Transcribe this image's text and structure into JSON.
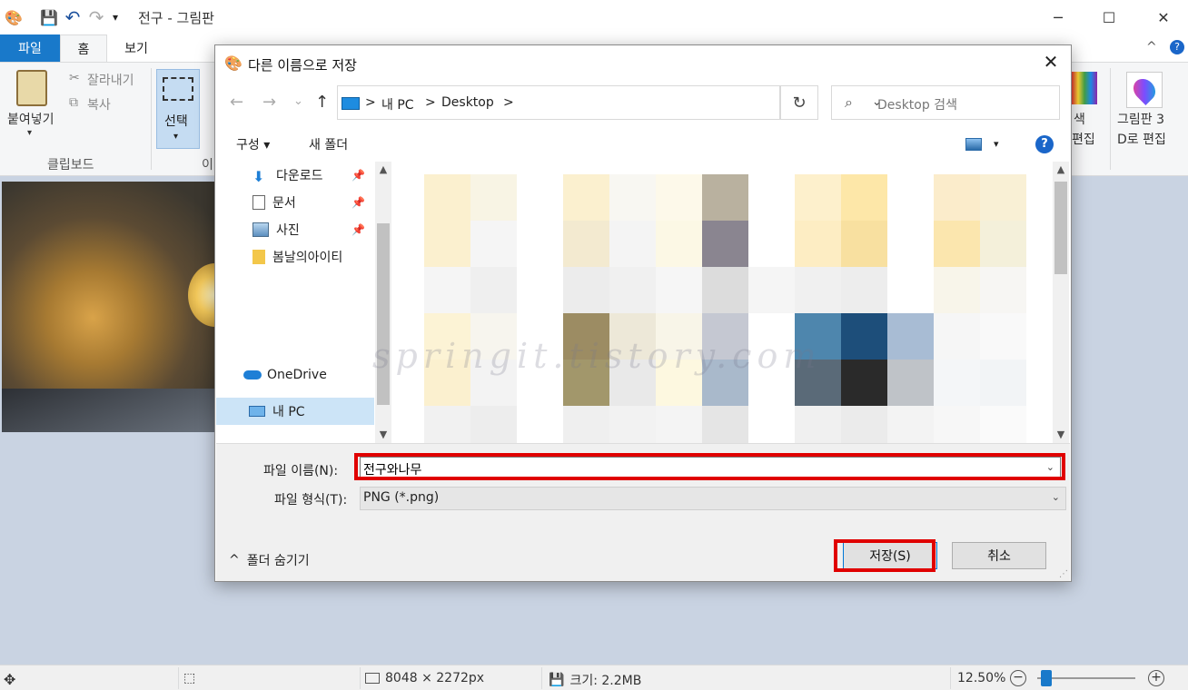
{
  "window": {
    "title": "전구 - 그림판",
    "minimize_icon": "─",
    "maximize_icon": "☐",
    "close_icon": "✕"
  },
  "quick_access": {
    "save_icon": "💾",
    "undo_icon": "↶",
    "redo_icon": "↷",
    "customize_icon": "▾",
    "app_icon": "🎨"
  },
  "tabs": {
    "file": "파일",
    "home": "홈",
    "view": "보기"
  },
  "ribbon": {
    "paste": "붙여넣기",
    "paste_icon": "📋",
    "cut": "잘라내기",
    "copy": "복사",
    "clipboard_group": "클립보드",
    "select": "선택",
    "image_group_partial": "이",
    "colors_partial": "색",
    "edit_colors_partial": "편집",
    "paint3d": "그림판 3",
    "paint3d_line2": "D로 편집",
    "collapse_icon": "^",
    "help_icon": "?"
  },
  "dialog": {
    "title": "다른 이름으로 저장",
    "back_icon": "←",
    "forward_icon": "→",
    "recent_icon": "⌄",
    "up_icon": "↑",
    "breadcrumb": [
      "내 PC",
      "Desktop"
    ],
    "crumb_sep": ">",
    "address_dropdown_icon": "⌄",
    "refresh_icon": "↻",
    "search_placeholder": "Desktop 검색",
    "search_icon": "⌕",
    "organize": "구성 ▾",
    "new_folder": "새 폴더",
    "view_menu_icon": "▾",
    "help": "?",
    "nav_items": [
      {
        "label": "다운로드",
        "pinned": true
      },
      {
        "label": "문서",
        "pinned": true
      },
      {
        "label": "사진",
        "pinned": true
      },
      {
        "label": "봄날의아이티",
        "pinned": false
      },
      {
        "label": "OneDrive",
        "pinned": false
      },
      {
        "label": "내 PC",
        "pinned": false
      }
    ],
    "pin_icon": "📌",
    "filename_label": "파일 이름(N):",
    "filename_value": "전구와나무",
    "filetype_label": "파일 형식(T):",
    "filetype_value": "PNG (*.png)",
    "dropdown_icon": "⌄",
    "hide_folders": "폴더 숨기기",
    "hide_folders_icon": "^",
    "save_button": "저장(S)",
    "cancel_button": "취소",
    "close_icon": "✕"
  },
  "watermark": "springit.tistory.com",
  "status": {
    "dimensions": "8048 × 2272px",
    "size": "크기: 2.2MB",
    "zoom": "12.50%",
    "zoom_level_percent": 12.5,
    "move_icon": "✥",
    "select_icon": "⬚",
    "zoom_out_icon": "−",
    "zoom_in_icon": "+"
  },
  "colors": {
    "accent": "#1979ca",
    "highlight": "#e00000",
    "selection": "#cce4f7"
  }
}
